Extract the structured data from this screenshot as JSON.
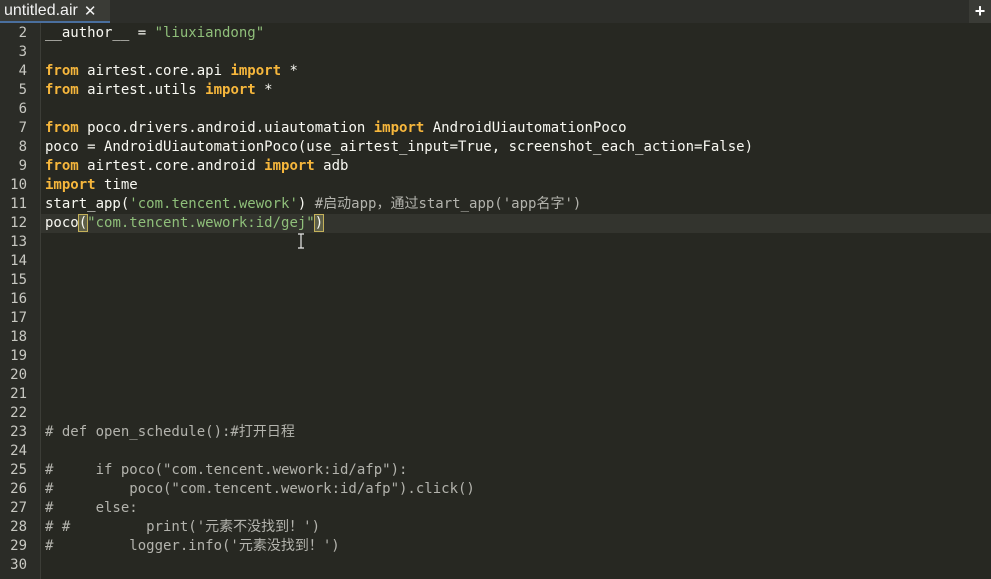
{
  "tab": {
    "title": "untitled.air",
    "close_glyph": "✕"
  },
  "new_tab_glyph": "+",
  "colors": {
    "background": "#272822",
    "keyword": "#f7b73c",
    "string": "#8fbf7a",
    "comment": "#b3b3ad",
    "text": "#f8f8f2"
  },
  "lines": [
    {
      "n": "2",
      "segments": [
        {
          "t": "__author__ = ",
          "c": "plain"
        },
        {
          "t": "\"liuxiandong\"",
          "c": "str"
        }
      ]
    },
    {
      "n": "3",
      "segments": []
    },
    {
      "n": "4",
      "segments": [
        {
          "t": "from",
          "c": "kw"
        },
        {
          "t": " airtest.core.api ",
          "c": "plain"
        },
        {
          "t": "import",
          "c": "kw"
        },
        {
          "t": " *",
          "c": "plain"
        }
      ]
    },
    {
      "n": "5",
      "segments": [
        {
          "t": "from",
          "c": "kw"
        },
        {
          "t": " airtest.utils ",
          "c": "plain"
        },
        {
          "t": "import",
          "c": "kw"
        },
        {
          "t": " *",
          "c": "plain"
        }
      ]
    },
    {
      "n": "6",
      "segments": []
    },
    {
      "n": "7",
      "segments": [
        {
          "t": "from",
          "c": "kw"
        },
        {
          "t": " poco.drivers.android.uiautomation ",
          "c": "plain"
        },
        {
          "t": "import",
          "c": "kw"
        },
        {
          "t": " AndroidUiautomationPoco",
          "c": "plain"
        }
      ]
    },
    {
      "n": "8",
      "segments": [
        {
          "t": "poco = AndroidUiautomationPoco(use_airtest_input=True, screenshot_each_action=False)",
          "c": "plain"
        }
      ]
    },
    {
      "n": "9",
      "segments": [
        {
          "t": "from",
          "c": "kw"
        },
        {
          "t": " airtest.core.android ",
          "c": "plain"
        },
        {
          "t": "import",
          "c": "kw"
        },
        {
          "t": " adb",
          "c": "plain"
        }
      ]
    },
    {
      "n": "10",
      "segments": [
        {
          "t": "import",
          "c": "kw"
        },
        {
          "t": " time",
          "c": "plain"
        }
      ]
    },
    {
      "n": "11",
      "segments": [
        {
          "t": "start_app(",
          "c": "plain"
        },
        {
          "t": "'com.tencent.wework'",
          "c": "str"
        },
        {
          "t": ") ",
          "c": "plain"
        },
        {
          "t": "#启动app，通过start_app('app名字')",
          "c": "cm"
        }
      ]
    },
    {
      "n": "12",
      "active": true,
      "segments": [
        {
          "t": "poco",
          "c": "plain"
        },
        {
          "t": "(",
          "c": "bracket"
        },
        {
          "t": "\"com.tencent.wework:id/gej\"",
          "c": "str"
        },
        {
          "t": ")",
          "c": "bracket"
        }
      ]
    },
    {
      "n": "13",
      "segments": []
    },
    {
      "n": "14",
      "segments": []
    },
    {
      "n": "15",
      "segments": []
    },
    {
      "n": "16",
      "segments": []
    },
    {
      "n": "17",
      "segments": []
    },
    {
      "n": "18",
      "segments": []
    },
    {
      "n": "19",
      "segments": []
    },
    {
      "n": "20",
      "segments": []
    },
    {
      "n": "21",
      "segments": []
    },
    {
      "n": "22",
      "segments": []
    },
    {
      "n": "23",
      "segments": [
        {
          "t": "# def open_schedule():#打开日程",
          "c": "cm"
        }
      ]
    },
    {
      "n": "24",
      "segments": []
    },
    {
      "n": "25",
      "segments": [
        {
          "t": "#     if poco(\"com.tencent.wework:id/afp\"):",
          "c": "cm"
        }
      ]
    },
    {
      "n": "26",
      "segments": [
        {
          "t": "#         poco(\"com.tencent.wework:id/afp\").click()",
          "c": "cm"
        }
      ]
    },
    {
      "n": "27",
      "segments": [
        {
          "t": "#     else:",
          "c": "cm"
        }
      ]
    },
    {
      "n": "28",
      "segments": [
        {
          "t": "# #         print('元素不没找到！')",
          "c": "cm"
        }
      ]
    },
    {
      "n": "29",
      "segments": [
        {
          "t": "#         logger.info('元素没找到！')",
          "c": "cm"
        }
      ]
    },
    {
      "n": "30",
      "segments": []
    }
  ]
}
